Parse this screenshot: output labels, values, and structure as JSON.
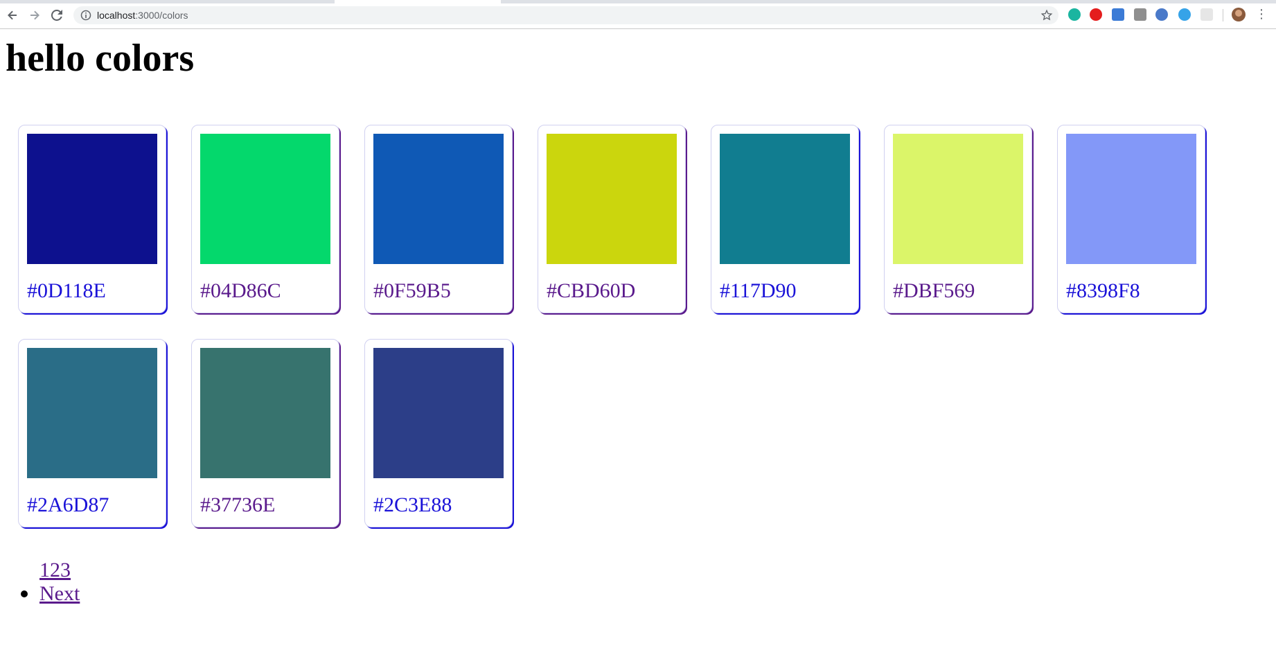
{
  "browser": {
    "url_host": "localhost",
    "url_path": ":3000/colors"
  },
  "page": {
    "title": "hello colors"
  },
  "colors": [
    {
      "hex": "#0D118E",
      "visited": false
    },
    {
      "hex": "#04D86C",
      "visited": true
    },
    {
      "hex": "#0F59B5",
      "visited": true
    },
    {
      "hex": "#CBD60D",
      "visited": true
    },
    {
      "hex": "#117D90",
      "visited": false
    },
    {
      "hex": "#DBF569",
      "visited": true
    },
    {
      "hex": "#8398F8",
      "visited": false
    },
    {
      "hex": "#2A6D87",
      "visited": false
    },
    {
      "hex": "#37736E",
      "visited": true
    },
    {
      "hex": "#2C3E88",
      "visited": false
    }
  ],
  "pagination": {
    "pages_label": "123",
    "next_label": "Next"
  },
  "theme": {
    "link_color": "#1A12D8",
    "visited_color": "#5A1A8C"
  }
}
